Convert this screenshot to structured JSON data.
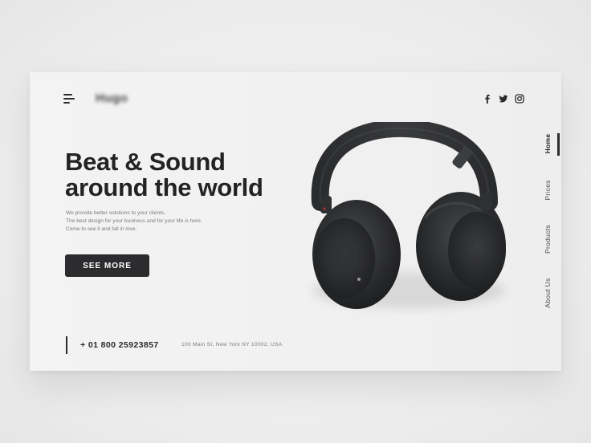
{
  "header": {
    "logo": "Hugo",
    "social": [
      "facebook-icon",
      "twitter-icon",
      "instagram-icon"
    ]
  },
  "hero": {
    "title_line1": "Beat & Sound",
    "title_line2": "around the world",
    "desc_line1": "We provide better solutions to your clients.",
    "desc_line2": "The best design for your business and for your life is here.",
    "desc_line3": "Come to see it and fall in love.",
    "cta_label": "SEE MORE"
  },
  "footer": {
    "phone": "+ 01 800 25923857",
    "address": "100 Main St, New York NY 10002, USA"
  },
  "nav": {
    "items": [
      {
        "label": "Home",
        "active": true
      },
      {
        "label": "Prices",
        "active": false
      },
      {
        "label": "Products",
        "active": false
      },
      {
        "label": "About Us",
        "active": false
      }
    ]
  },
  "colors": {
    "text_dark": "#232323",
    "button_bg": "#2c2c2e",
    "muted": "#7a7a7a"
  }
}
